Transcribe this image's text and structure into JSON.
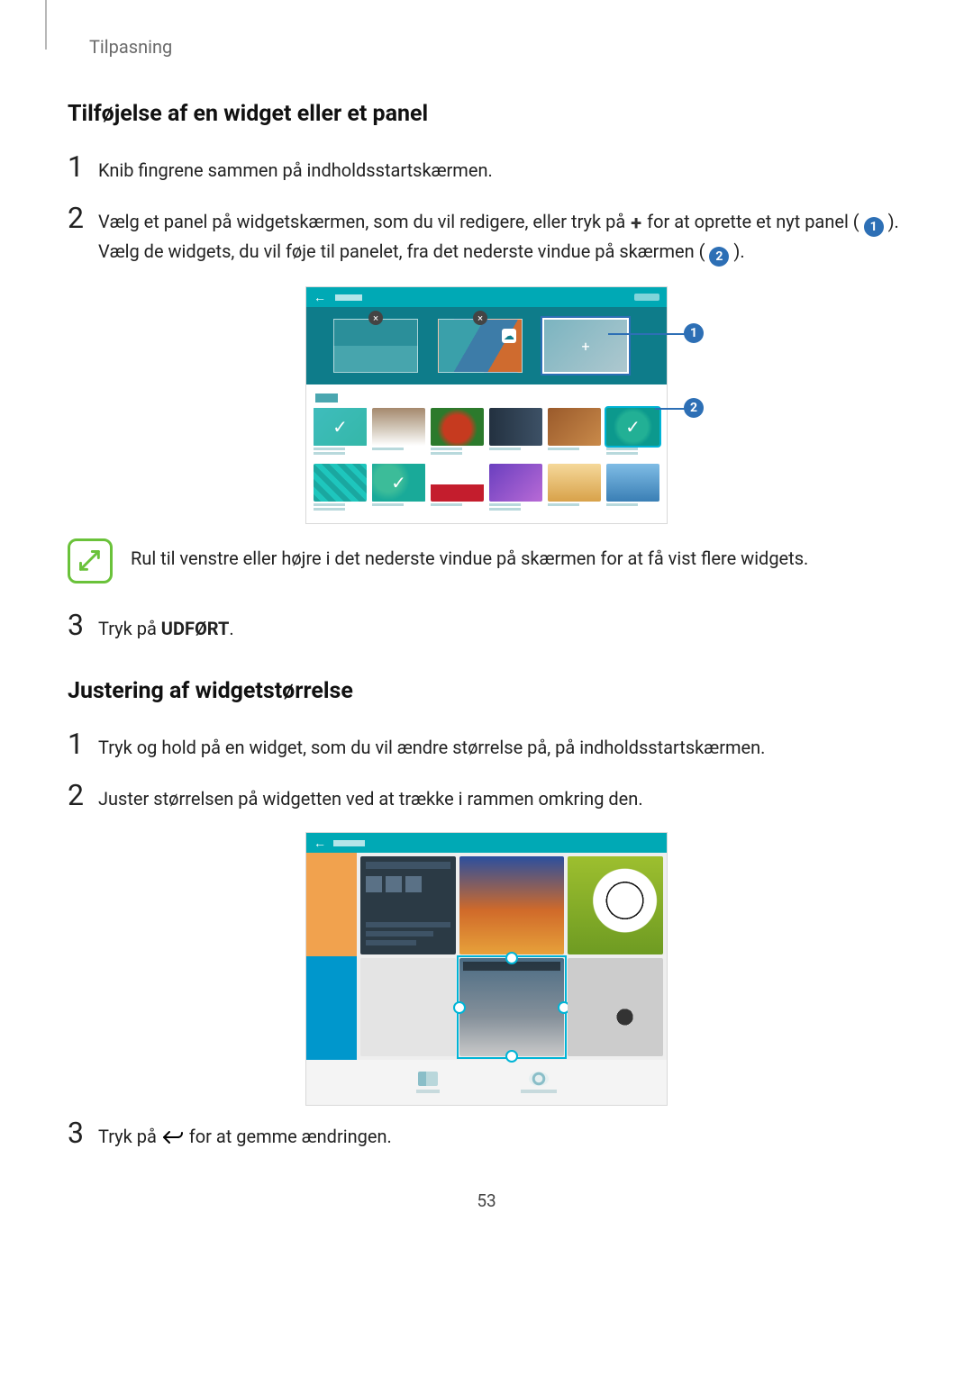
{
  "runningHead": "Tilpasning",
  "sectionA": {
    "title": "Tilføjelse af en widget eller et panel",
    "step1": "Knib fingrene sammen på indholdsstartskærmen.",
    "step2_a": "Vælg et panel på widgetskærmen, som du vil redigere, eller tryk på ",
    "step2_b": " for at oprette et nyt panel ( ",
    "step2_c": " ). Vælg de widgets, du vil føje til panelet, fra det nederste vindue på skærmen ( ",
    "step2_d": " ).",
    "badge1": "1",
    "badge2": "2",
    "note": "Rul til venstre eller højre i det nederste vindue på skærmen for at få vist flere widgets.",
    "step3_a": "Tryk på ",
    "step3_b": "UDFØRT",
    "step3_c": "."
  },
  "sectionB": {
    "title": "Justering af widgetstørrelse",
    "step1": "Tryk og hold på en widget, som du vil ændre størrelse på, på indholdsstartskærmen.",
    "step2": "Juster størrelsen på widgetten ved at trække i rammen omkring den.",
    "step3_a": "Tryk på ",
    "step3_b": " for at gemme ændringen."
  },
  "numbers": {
    "n1": "1",
    "n2": "2",
    "n3": "3"
  },
  "callouts": {
    "c1": "1",
    "c2": "2"
  },
  "pageNumber": "53"
}
